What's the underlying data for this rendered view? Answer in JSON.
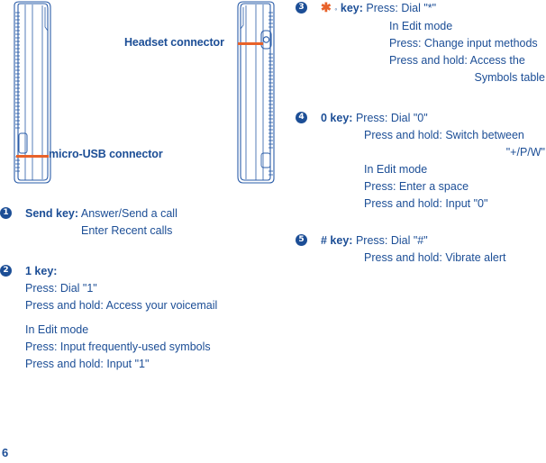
{
  "page": {
    "number": "6"
  },
  "illustration": {
    "callouts": [
      {
        "id": "headset",
        "label": "Headset connector"
      },
      {
        "id": "micro-usb",
        "label": "micro-USB connector"
      }
    ],
    "accent_color": "#E8622A",
    "line_color": "#1c4e96"
  },
  "entries": [
    {
      "marker": "1",
      "term": "Send key:",
      "head": "Answer/Send a call",
      "lines": [
        "Enter Recent calls"
      ]
    },
    {
      "marker": "2",
      "term": "1 key:",
      "lines_block_1": [
        "Press: Dial \"1\"",
        "Press and hold: Access your voicemail"
      ],
      "lines_block_2": [
        "In Edit mode",
        "Press: Input frequently-used symbols",
        "Press and hold: Input \"1\""
      ]
    },
    {
      "marker": "3",
      "term_symbol": "✱",
      "term_ring": "◦",
      "term": "key:",
      "head": "Press: Dial \"*\"",
      "lines": [
        "In Edit mode",
        "Press: Change input methods",
        "Press and hold: Access the"
      ],
      "wrap_line": "Symbols table"
    },
    {
      "marker": "4",
      "term": "0 key:",
      "head": "Press: Dial \"0\"",
      "lines": [
        "Press and hold: Switch between"
      ],
      "wrap_line": "\"+/P/W\"",
      "lines_after": [
        "In Edit mode",
        "Press: Enter a space",
        "Press and hold: Input \"0\""
      ]
    },
    {
      "marker": "5",
      "term": "# key:",
      "head": "Press: Dial \"#\"",
      "lines": [
        "Press and hold: Vibrate alert"
      ]
    }
  ]
}
